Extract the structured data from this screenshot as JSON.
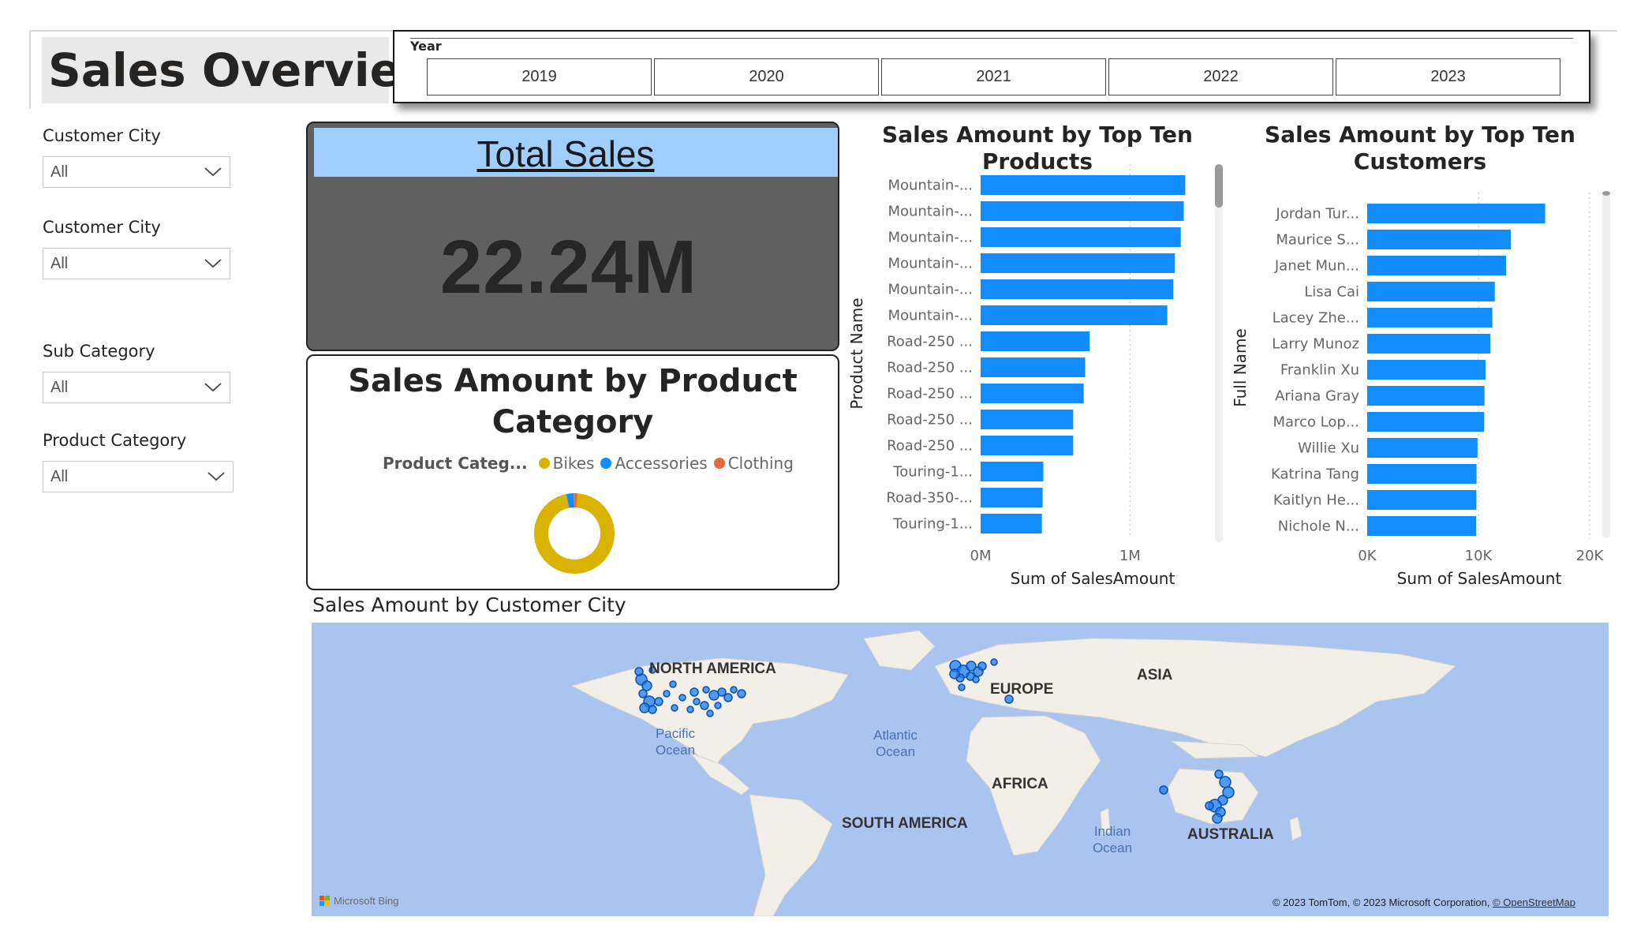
{
  "title": "Sales Overview",
  "year_slicer": {
    "label": "Year",
    "years": [
      "2019",
      "2020",
      "2021",
      "2022",
      "2023"
    ]
  },
  "filters": [
    {
      "label": "Customer City",
      "value": "All"
    },
    {
      "label": "Customer City",
      "value": "All"
    },
    {
      "label": "Sub Category",
      "value": "All"
    },
    {
      "label": "Product Category",
      "value": "All"
    }
  ],
  "total_sales": {
    "title": "Total Sales",
    "value": "22.24M"
  },
  "product_category": {
    "title": "Sales Amount by Product Category",
    "legend_title": "Product Categ...",
    "colors": {
      "Bikes": "#d9b300",
      "Accessories": "#118dff",
      "Clothing": "#e66c37"
    }
  },
  "chart_data": [
    {
      "type": "pie",
      "title": "Sales Amount by Product Category",
      "legend_title": "Product Categ...",
      "categories": [
        "Bikes",
        "Accessories",
        "Clothing"
      ],
      "values": [
        0.955,
        0.03,
        0.015
      ],
      "colors": [
        "#d9b300",
        "#118dff",
        "#e66c37"
      ],
      "donut": true
    },
    {
      "type": "bar",
      "orientation": "horizontal",
      "title": "Sales Amount by Top Ten Products",
      "xlabel": "Sum of SalesAmount",
      "ylabel": "Product Name",
      "categories": [
        "Mountain-...",
        "Mountain-...",
        "Mountain-...",
        "Mountain-...",
        "Mountain-...",
        "Mountain-...",
        "Road-250 ...",
        "Road-250 ...",
        "Road-250 ...",
        "Road-250 ...",
        "Road-250 ...",
        "Touring-1...",
        "Road-350-...",
        "Touring-1..."
      ],
      "values": [
        1370000,
        1360000,
        1340000,
        1300000,
        1290000,
        1250000,
        730000,
        700000,
        690000,
        620000,
        620000,
        420000,
        415000,
        410000
      ],
      "xlim": [
        0,
        1500000
      ],
      "xticks": [
        "0M",
        "1M"
      ],
      "xtick_values": [
        0,
        1000000
      ],
      "color": "#118dff"
    },
    {
      "type": "bar",
      "orientation": "horizontal",
      "title": "Sales Amount by Top Ten Customers",
      "xlabel": "Sum of SalesAmount",
      "ylabel": "Full Name",
      "categories": [
        "Jordan Tur...",
        "Maurice S...",
        "Janet Mun...",
        "Lisa Cai",
        "Lacey Zhe...",
        "Larry Munoz",
        "Franklin Xu",
        "Ariana Gray",
        "Marco Lop...",
        "Willie Xu",
        "Katrina Tang",
        "Kaitlyn He...",
        "Nichole N..."
      ],
      "values": [
        15999,
        12909,
        12489,
        11469,
        11249,
        11068,
        10633,
        10543,
        10516,
        9918,
        9832,
        9812,
        9788
      ],
      "xlim": [
        0,
        20000
      ],
      "xticks": [
        "0K",
        "10K",
        "20K"
      ],
      "xtick_values": [
        0,
        10000,
        20000
      ],
      "color": "#118dff"
    }
  ],
  "map": {
    "title": "Sales Amount by Customer City",
    "continents": [
      "NORTH AMERICA",
      "EUROPE",
      "ASIA",
      "AFRICA",
      "SOUTH AMERICA",
      "AUSTRALIA"
    ],
    "oceans": [
      "Pacific Ocean",
      "Atlantic Ocean",
      "Indian Ocean"
    ],
    "provider": "Microsoft Bing",
    "attribution": "© 2023 TomTom, © 2023 Microsoft Corporation, ",
    "attribution_link": "© OpenStreetMap"
  }
}
